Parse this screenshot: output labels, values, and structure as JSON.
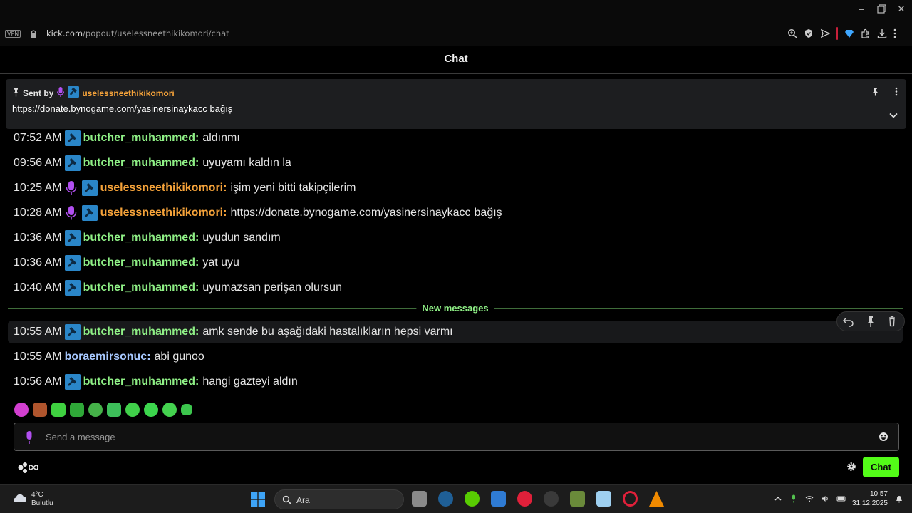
{
  "browser": {
    "vpn_label": "VPN",
    "url_host": "kick.com",
    "url_path": "/popout/uselessneethikikomori/chat"
  },
  "chat": {
    "title": "Chat",
    "pinned": {
      "sent_by_label": "Sent by",
      "username": "uselessneethikikomori",
      "link": "https://donate.bynogame.com/yasinersinaykacc",
      "suffix": "bağış"
    },
    "messages": [
      {
        "time": "07:52 AM",
        "user": "butcher_muhammed",
        "text": "aldınmı"
      },
      {
        "time": "09:56 AM",
        "user": "butcher_muhammed",
        "text": "uyuyamı kaldın la"
      },
      {
        "time": "10:25 AM",
        "user": "uselessneethikikomori",
        "text": "işim yeni bitti takipçilerim"
      },
      {
        "time": "10:28 AM",
        "user": "uselessneethikikomori",
        "link": "https://donate.bynogame.com/yasinersinaykacc",
        "text": "bağış"
      },
      {
        "time": "10:36 AM",
        "user": "butcher_muhammed",
        "text": "uyudun sandım"
      },
      {
        "time": "10:36 AM",
        "user": "butcher_muhammed",
        "text": "yat uyu"
      },
      {
        "time": "10:40 AM",
        "user": "butcher_muhammed",
        "text": "uyumazsan perişan olursun"
      },
      {
        "time": "10:55 AM",
        "user": "butcher_muhammed",
        "text": "amk sende bu aşağıdaki hastalıkların hepsi varmı"
      },
      {
        "time": "10:55 AM",
        "user": "boraemirsonuc",
        "text": "abi gunoo"
      },
      {
        "time": "10:56 AM",
        "user": "butcher_muhammed",
        "text": "hangi gazteyi aldın"
      }
    ],
    "new_messages_label": "New messages",
    "input_placeholder": "Send a message",
    "send_button": "Chat"
  },
  "taskbar": {
    "temperature": "4°C",
    "weather": "Bulutlu",
    "search_label": "Ara",
    "time": "10:57",
    "date": "31.12.2025"
  },
  "colors": {
    "accent_green": "#53fc18",
    "user_green": "#8ff086",
    "user_orange": "#f6a33a",
    "user_blue": "#a7c8ff"
  }
}
